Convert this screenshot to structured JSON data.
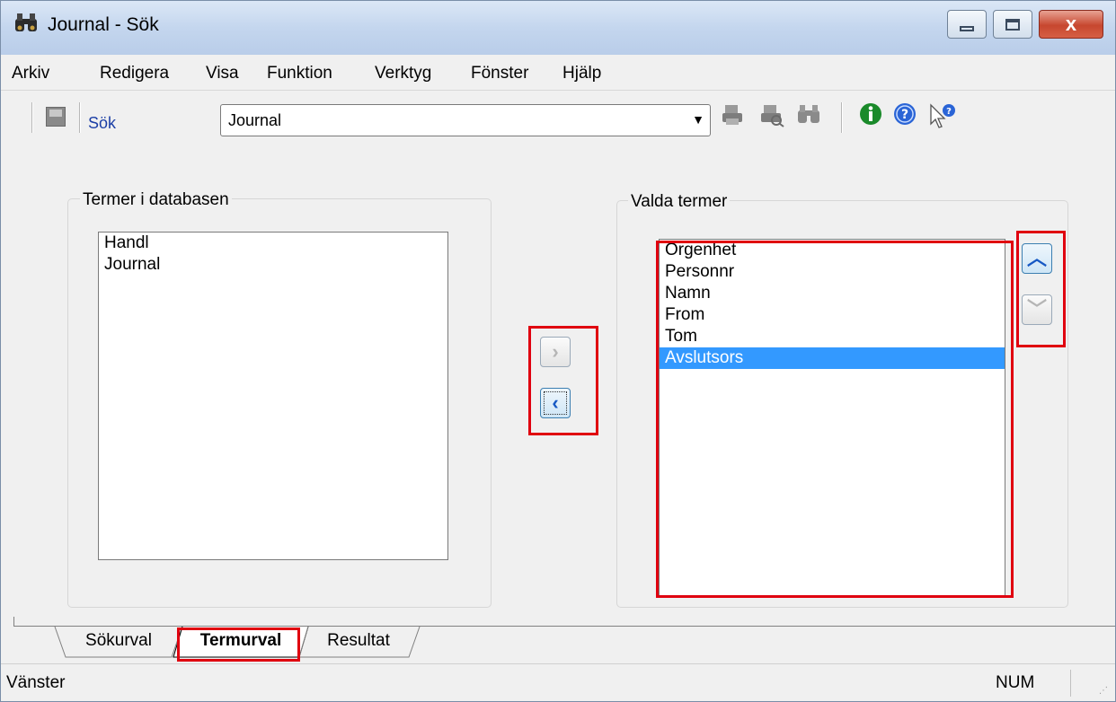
{
  "window": {
    "title": "Journal - Sök",
    "title_icon": "binoculars-icon",
    "caption": {
      "close_glyph": "x"
    }
  },
  "menu": {
    "items": [
      "Arkiv",
      "Redigera",
      "Visa",
      "Funktion",
      "Verktyg",
      "Fönster",
      "Hjälp"
    ]
  },
  "toolbar": {
    "search_label": "Sök",
    "combo_value": "Journal",
    "icons": [
      "printer-icon",
      "print-preview-icon",
      "binoculars-icon",
      "info-icon",
      "help-icon",
      "whats-this-icon"
    ]
  },
  "left_group": {
    "label": "Termer i databasen",
    "items": [
      "Handl",
      "Journal"
    ]
  },
  "right_group": {
    "label": "Valda termer",
    "items": [
      "Orgenhet",
      "Personnr",
      "Namn",
      "From",
      "Tom",
      "Avslutsors"
    ],
    "selected_index": 5
  },
  "transfer_buttons": {
    "add_glyph": "›",
    "remove_glyph": "‹"
  },
  "order_buttons": {
    "up_glyph": "︿",
    "down_glyph": "﹀"
  },
  "tabs": [
    "Sökurval",
    "Termurval",
    "Resultat"
  ],
  "active_tab": 1,
  "status": {
    "text": "Vänster",
    "num": "NUM"
  },
  "colors": {
    "highlight": "#e0000f",
    "selection": "#3399ff",
    "link_blue": "#1c3fa6"
  }
}
